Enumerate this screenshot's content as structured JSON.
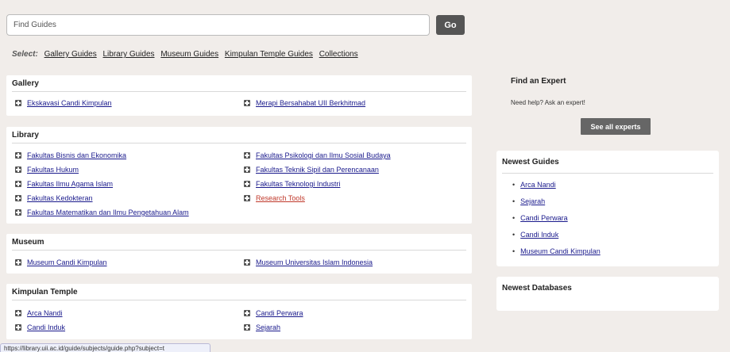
{
  "search": {
    "placeholder": "Find Guides",
    "go_label": "Go"
  },
  "select": {
    "label": "Select:",
    "options": [
      "Gallery Guides",
      "Library Guides",
      "Museum Guides",
      "Kimpulan Temple Guides",
      "Collections"
    ]
  },
  "gallery": {
    "title": "Gallery",
    "col1": [
      "Ekskavasi Candi Kimpulan"
    ],
    "col2": [
      "Merapi Bersahabat UII Berkhitmad"
    ]
  },
  "library": {
    "title": "Library",
    "col1": [
      "Fakultas Bisnis dan Ekonomika",
      "Fakultas Hukum",
      "Fakultas Ilmu Agama Islam",
      "Fakultas Kedokteran",
      "Fakultas Matematikan dan Ilmu Pengetahuan Alam"
    ],
    "col2": [
      "Fakultas Psikologi dan Ilmu Sosial Budaya",
      "Fakultas Teknik Sipil dan Perencanaan",
      "Fakultas Teknologi Industri",
      "Research Tools"
    ]
  },
  "museum": {
    "title": "Museum",
    "col1": [
      "Museum Candi Kimpulan"
    ],
    "col2": [
      "Museum Universitas Islam Indonesia"
    ]
  },
  "kimpulan": {
    "title": "Kimpulan Temple",
    "col1": [
      "Arca Nandi",
      "Candi Induk"
    ],
    "col2": [
      "Candi Perwara",
      "Sejarah"
    ]
  },
  "find_expert": {
    "title": "Find an Expert",
    "text": "Need help? Ask an expert!",
    "button": "See all experts"
  },
  "newest_guides": {
    "title": "Newest Guides",
    "items": [
      "Arca Nandi",
      "Sejarah",
      "Candi Perwara",
      "Candi Induk",
      "Museum Candi Kimpulan"
    ]
  },
  "newest_databases": {
    "title": "Newest Databases"
  },
  "status_bar": {
    "url": "https://library.uii.ac.id/guide/subjects/guide.php?subject=t"
  },
  "colors": {
    "background": "#f1edea",
    "link": "#1a1a8c",
    "highlight_link": "#c0392b",
    "button": "#555555"
  }
}
